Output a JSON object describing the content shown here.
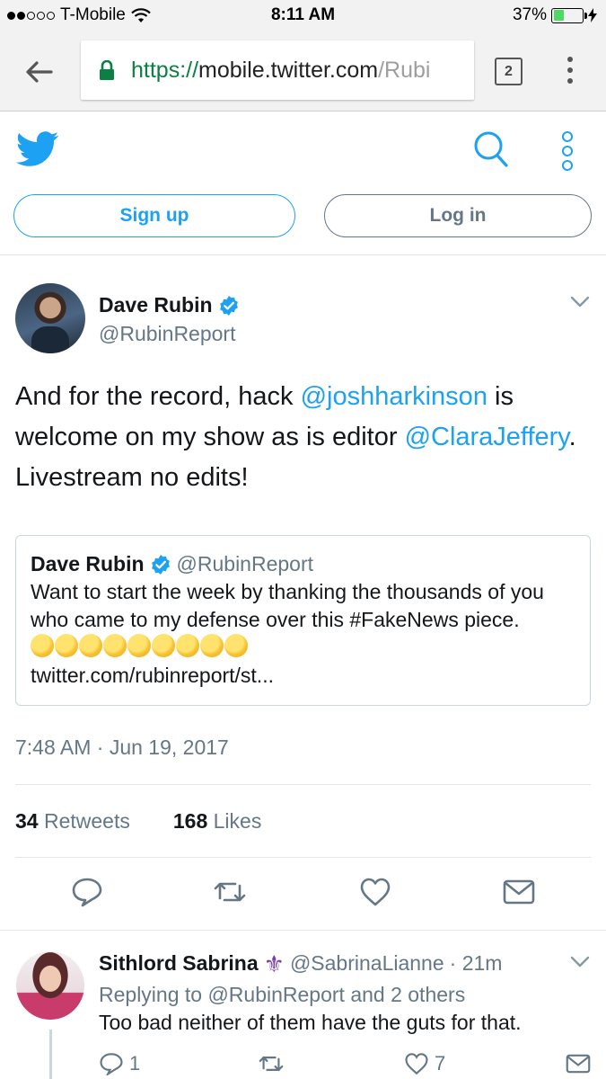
{
  "status_bar": {
    "carrier": "T-Mobile",
    "time": "8:11 AM",
    "battery_percent": "37%",
    "battery_level": 0.37,
    "signal_bars_filled": 2,
    "signal_bars_total": 5
  },
  "browser": {
    "url_scheme": "https://",
    "url_host": "mobile.twitter.com",
    "url_path": "/Rubi",
    "tab_count": "2",
    "icons": [
      "back-arrow-icon",
      "lock-icon",
      "tabs-icon",
      "kebab-menu-icon"
    ]
  },
  "twitter_header": {
    "signup_label": "Sign up",
    "login_label": "Log in",
    "icons": [
      "twitter-bird-icon",
      "search-icon",
      "more-icon"
    ]
  },
  "tweet": {
    "author_name": "Dave Rubin",
    "author_handle": "@RubinReport",
    "text_part1": "And for the record, hack ",
    "mention1": "@joshharkinson",
    "text_part2": " is welcome on my show as is editor ",
    "mention2": "@ClaraJeffery",
    "text_part3": ". Livestream no edits!",
    "quote": {
      "author_name": "Dave Rubin",
      "author_handle": "@RubinReport",
      "text": "Want to start the week by thanking the thousands of you who came to my defense over this #FakeNews piece.",
      "emoji_count": 9,
      "link": "twitter.com/rubinreport/st..."
    },
    "timestamp": "7:48 AM · Jun 19, 2017",
    "retweets_count": "34",
    "retweets_label": "Retweets",
    "likes_count": "168",
    "likes_label": "Likes",
    "action_icons": [
      "reply-icon",
      "retweet-icon",
      "like-icon",
      "message-icon"
    ]
  },
  "reply": {
    "author_name": "Sithlord Sabrina",
    "author_handle": "@SabrinaLianne",
    "time_ago": "· 21m",
    "replying_to": "Replying to @RubinReport and 2 others",
    "text": "Too bad neither of them have the guts for that.",
    "reply_count": "1",
    "like_count": "7"
  },
  "colors": {
    "twitter_blue": "#1da1f2",
    "secure_green": "#0b8043",
    "secondary_text": "#657786",
    "border": "#e1e8ed"
  }
}
